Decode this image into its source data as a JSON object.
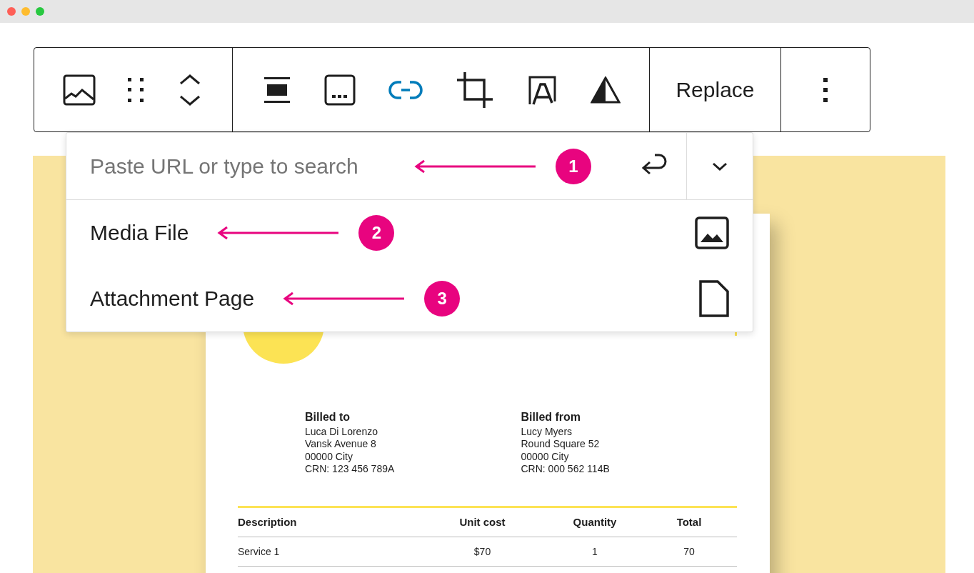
{
  "toolbar": {
    "link_selected": true,
    "replace_label": "Replace"
  },
  "link_popover": {
    "search": {
      "placeholder": "Paste URL or type to search",
      "callout": "1"
    },
    "options": [
      {
        "label": "Media File",
        "callout": "2"
      },
      {
        "label": "Attachment Page",
        "callout": "3"
      }
    ]
  },
  "invoice": {
    "parties": [
      {
        "heading": "Billed to",
        "lines": [
          "Luca Di Lorenzo",
          "Vansk Avenue 8",
          "00000 City",
          "CRN: 123 456 789A"
        ]
      },
      {
        "heading": "Billed from",
        "lines": [
          "Lucy Myers",
          "Round Square 52",
          "00000 City",
          "CRN: 000 562 114B"
        ]
      }
    ],
    "table": {
      "columns": [
        "Description",
        "Unit cost",
        "Quantity",
        "Total"
      ],
      "rows": [
        [
          "Service 1",
          "$70",
          "1",
          "70"
        ]
      ]
    }
  }
}
